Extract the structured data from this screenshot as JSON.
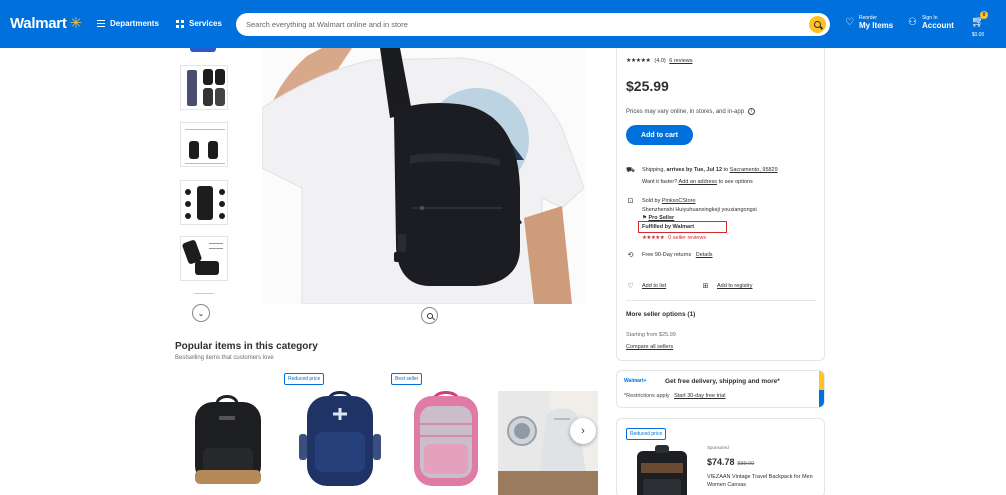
{
  "header": {
    "logo": "Walmart",
    "departments": "Departments",
    "services": "Services",
    "search_placeholder": "Search everything at Walmart online and in store",
    "reorder_small": "Reorder",
    "reorder_big": "My Items",
    "signin_small": "Sign In",
    "signin_big": "Account",
    "cart_count": "0",
    "cart_total": "$0.00"
  },
  "buybox": {
    "rating_stars": "★★★★★",
    "rating_value": "(4.0)",
    "reviews_link": "6 reviews",
    "price": "$25.99",
    "price_note": "Prices may vary online, in stores, and in-app",
    "add_to_cart": "Add to cart",
    "shipping_label": "Shipping,",
    "shipping_arrives": "arrives by Tue, Jul 12",
    "shipping_to": "to",
    "shipping_location": "Sacramento, 95829",
    "want_faster": "Want it faster?",
    "add_address": "Add an address",
    "see_options": "to see options",
    "sold_by": "Sold by",
    "seller_link": "PinksoCStore",
    "seller_full": "Shenzhenshi Huiyuhuanxingkeji youxiangongsi",
    "pro_seller": "Pro Seller",
    "fulfilled": "Fulfilled by Walmart",
    "seller_stars": "★★★★★",
    "seller_reviews": "0 seller reviews",
    "returns": "Free 90-Day returns",
    "returns_details": "Details",
    "add_to_list": "Add to list",
    "add_to_registry": "Add to registry",
    "more_sellers_title": "More seller options (1)",
    "starting_from": "Starting from $25.99",
    "compare_sellers": "Compare all sellers"
  },
  "promo": {
    "walmart_plus": "Walmart+",
    "headline": "Get free delivery, shipping and more*",
    "restrictions": "*Restrictions apply",
    "trial_link": "Start 30-day free trial"
  },
  "side_product": {
    "tag": "Reduced price",
    "sponsored": "Sponsored",
    "price": "$74.78",
    "old_price": "$89.00",
    "name": "VIEZAAN Vintage Travel Backpack for Men Women Canvas"
  },
  "popular": {
    "title": "Popular items in this category",
    "subtitle": "Bestselling items that customers love",
    "tag_reduced": "Reduced price",
    "tag_best": "Best seller"
  },
  "colors": {
    "brand_blue": "#0071dc",
    "spark_yellow": "#ffc220",
    "highlight_red": "#d12c2c"
  },
  "icons": [
    "spark-icon",
    "menu-icon",
    "grid-icon",
    "search-icon",
    "heart-icon",
    "user-icon",
    "cart-icon",
    "chevron-down-icon",
    "zoom-icon",
    "info-icon",
    "truck-icon",
    "lock-icon",
    "return-icon",
    "chevron-right-icon"
  ]
}
